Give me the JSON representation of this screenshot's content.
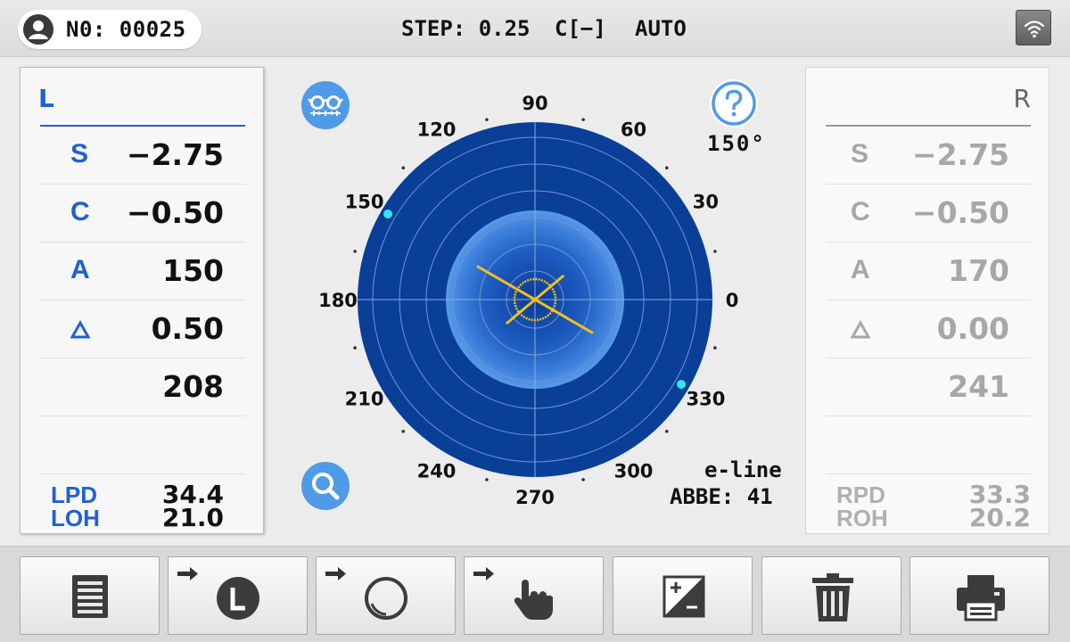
{
  "header": {
    "patient_label": "N0: 00025",
    "step": "STEP: 0.25",
    "cyl_mode": "C[−]",
    "mode": "AUTO",
    "wifi_icon": "wifi-icon"
  },
  "left_panel": {
    "eye": "L",
    "rows": [
      {
        "label": "S",
        "value": "−2.75"
      },
      {
        "label": "C",
        "value": "−0.50"
      },
      {
        "label": "A",
        "value": "150"
      },
      {
        "label": "Δ",
        "value": "0.50"
      },
      {
        "label": "",
        "value": "208"
      }
    ],
    "pd_label": "LPD",
    "pd_value": "34.4",
    "oh_label": "LOH",
    "oh_value": "21.0"
  },
  "right_panel": {
    "eye": "R",
    "rows": [
      {
        "label": "S",
        "value": "−2.75"
      },
      {
        "label": "C",
        "value": "−0.50"
      },
      {
        "label": "A",
        "value": "170"
      },
      {
        "label": "Δ",
        "value": "0.00"
      },
      {
        "label": "",
        "value": "241"
      }
    ],
    "pd_label": "RPD",
    "pd_value": "33.3",
    "oh_label": "ROH",
    "oh_value": "20.2"
  },
  "center": {
    "angle_readout": "150°",
    "eline": "e-line",
    "abbe": "ABBE: 41",
    "dial_labels": [
      "0",
      "30",
      "60",
      "90",
      "120",
      "150",
      "180",
      "210",
      "240",
      "270",
      "300",
      "330"
    ],
    "axis_angle_deg": 150,
    "dial_color": "#0a3f98",
    "marker_color": "#2ee8f2",
    "cross_color": "#f2c01e"
  },
  "toolbar": {
    "buttons": [
      {
        "name": "list-button",
        "icon": "list-icon"
      },
      {
        "name": "select-left-button",
        "icon": "left-eye-icon"
      },
      {
        "name": "lens-mode-button",
        "icon": "lens-circle-icon"
      },
      {
        "name": "touch-mode-button",
        "icon": "hand-touch-icon"
      },
      {
        "name": "sign-toggle-button",
        "icon": "plus-minus-icon"
      },
      {
        "name": "delete-button",
        "icon": "trash-icon"
      },
      {
        "name": "print-button",
        "icon": "printer-icon"
      }
    ]
  }
}
